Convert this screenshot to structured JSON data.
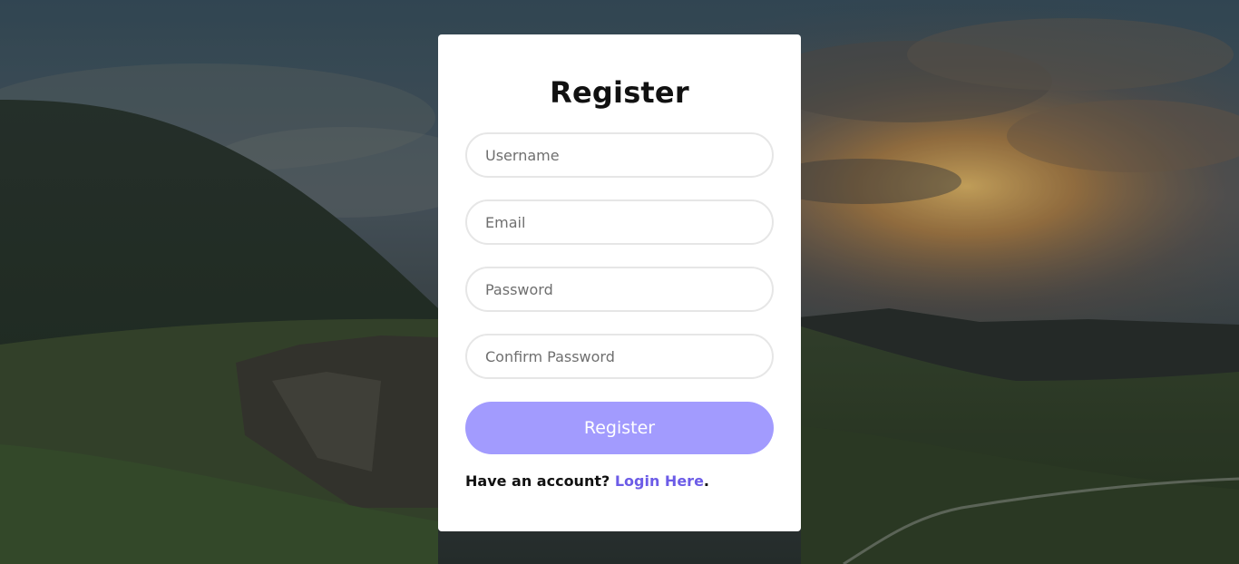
{
  "form": {
    "title": "Register",
    "username_placeholder": "Username",
    "email_placeholder": "Email",
    "password_placeholder": "Password",
    "confirm_password_placeholder": "Confirm Password",
    "submit_label": "Register",
    "footer_prefix": "Have an account? ",
    "login_link_label": "Login Here",
    "footer_suffix": "."
  },
  "colors": {
    "button_bg": "#a29bfe",
    "link": "#6c5ce7",
    "card_bg": "#ffffff",
    "field_border": "#e6e6e6"
  }
}
